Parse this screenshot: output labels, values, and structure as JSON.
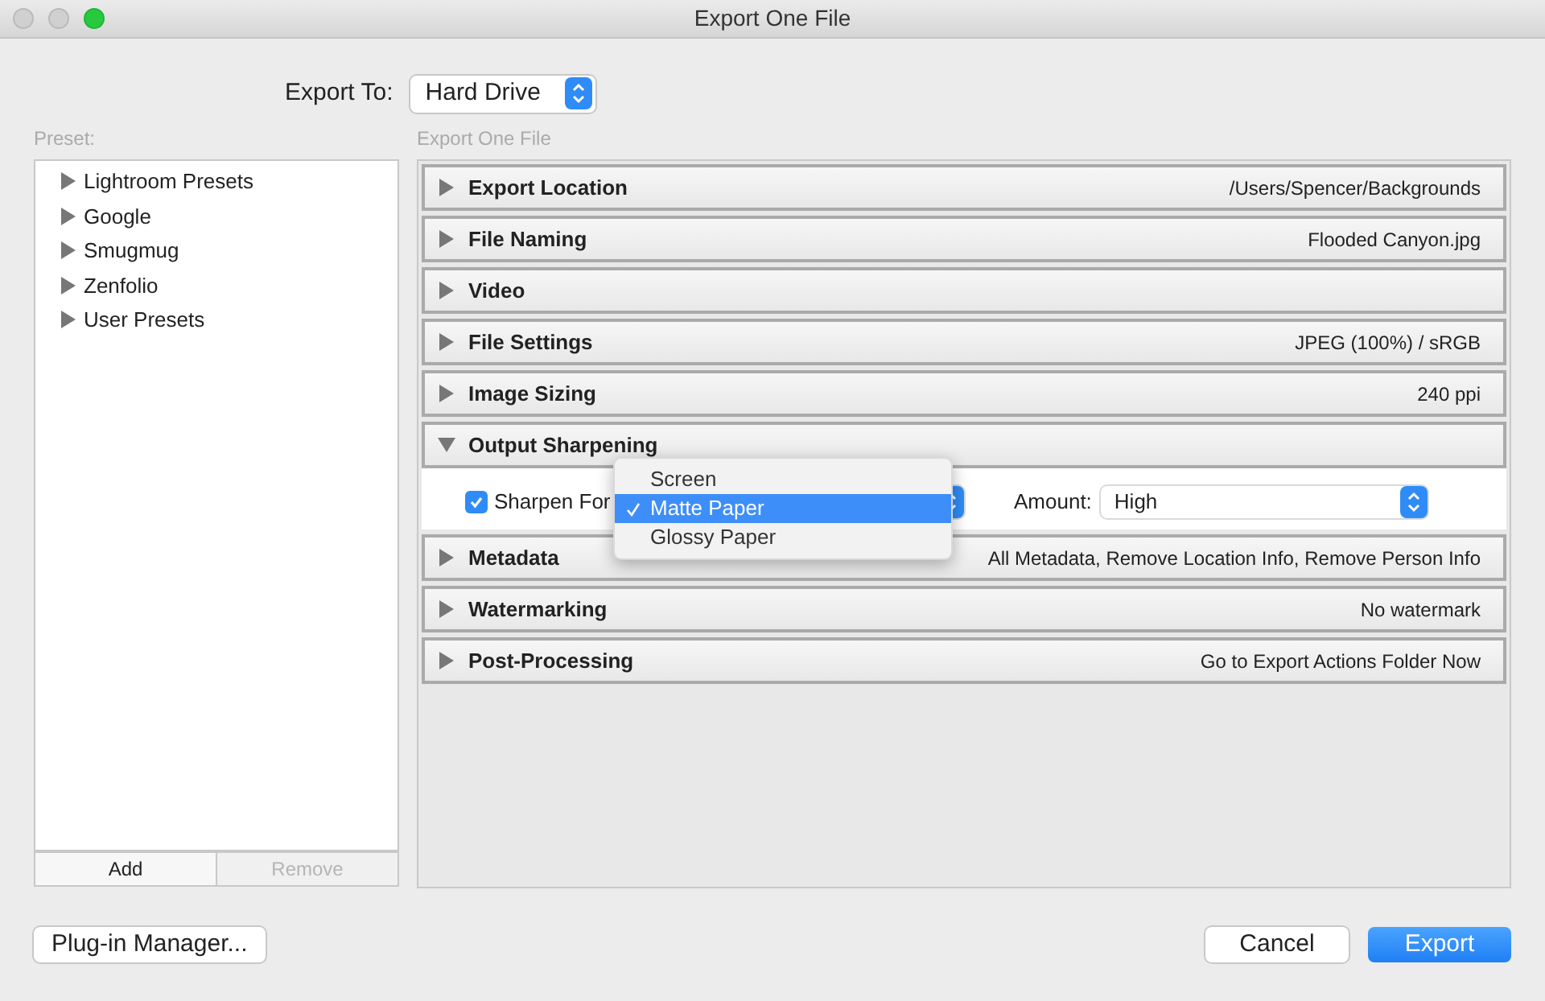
{
  "window": {
    "title": "Export One File"
  },
  "export_to": {
    "label": "Export To:",
    "value": "Hard Drive"
  },
  "preset": {
    "label": "Preset:",
    "items": [
      {
        "label": "Lightroom Presets",
        "expanded": false
      },
      {
        "label": "Google",
        "expanded": false
      },
      {
        "label": "Smugmug",
        "expanded": false
      },
      {
        "label": "Zenfolio",
        "expanded": false
      },
      {
        "label": "User Presets",
        "expanded": false
      }
    ],
    "buttons": [
      {
        "label": "Add",
        "disabled": false
      },
      {
        "label": "Remove",
        "disabled": true
      }
    ]
  },
  "panel": {
    "title": "Export One File",
    "sections": [
      {
        "title": "Export Location",
        "summary": "/Users/Spencer/Backgrounds",
        "expanded": false
      },
      {
        "title": "File Naming",
        "summary": "Flooded Canyon.jpg",
        "expanded": false
      },
      {
        "title": "Video",
        "expanded": false
      },
      {
        "title": "File Settings",
        "summary": "JPEG (100%) / sRGB",
        "expanded": false
      },
      {
        "title": "Image Sizing",
        "summary": "240 ppi",
        "expanded": false
      },
      {
        "title": "Output Sharpening",
        "expanded": true,
        "sharpen_for": {
          "label": "Sharpen For",
          "checked": true
        },
        "amount": {
          "label": "Amount:",
          "value": "High"
        }
      },
      {
        "title": "Metadata",
        "summary": "All Metadata, Remove Location Info, Remove Person Info",
        "expanded": false
      },
      {
        "title": "Watermarking",
        "summary": "No watermark",
        "expanded": false
      },
      {
        "title": "Post-Processing",
        "summary": "Go to Export Actions Folder Now",
        "expanded": false
      }
    ]
  },
  "menu": {
    "items": [
      {
        "label": "Screen",
        "selected": false
      },
      {
        "label": "Matte Paper",
        "selected": true
      },
      {
        "label": "Glossy Paper",
        "selected": false
      }
    ]
  },
  "buttons": [
    {
      "label": "Plug-in Manager...",
      "kind": "plain"
    },
    {
      "label": "Cancel",
      "kind": "plain"
    },
    {
      "label": "Export",
      "kind": "default"
    }
  ]
}
